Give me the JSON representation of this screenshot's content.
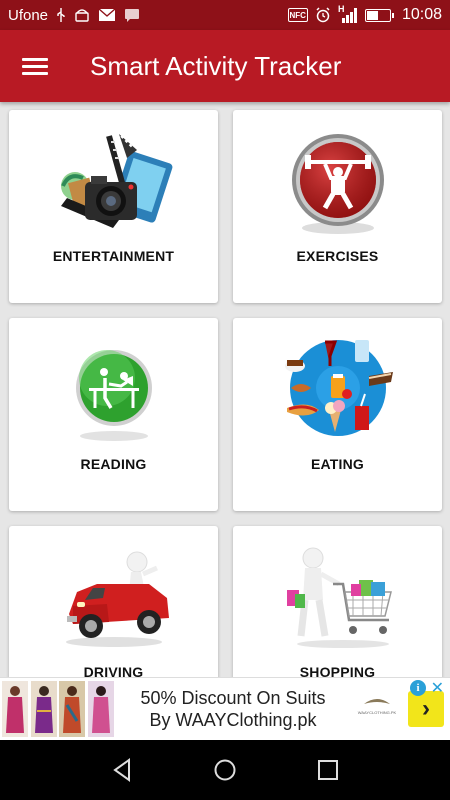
{
  "status_bar": {
    "carrier": "Ufone",
    "time": "10:08",
    "nfc_label": "NFC",
    "signal_label": "H",
    "battery_level": 0.45,
    "icons": [
      "usb-icon",
      "android-icon",
      "gmail-icon",
      "message-icon",
      "nfc-icon",
      "alarm-icon",
      "signal-icon",
      "battery-icon"
    ]
  },
  "app_bar": {
    "title": "Smart Activity Tracker",
    "menu_icon": "hamburger-menu-icon"
  },
  "categories": [
    {
      "label": "ENTERTAINMENT",
      "icon": "camera-film-icon"
    },
    {
      "label": "EXERCISES",
      "icon": "weightlifter-icon"
    },
    {
      "label": "READING",
      "icon": "reading-person-icon"
    },
    {
      "label": "EATING",
      "icon": "food-plate-icon"
    },
    {
      "label": "DRIVING",
      "icon": "red-car-icon"
    },
    {
      "label": "SHOPPING",
      "icon": "shopping-cart-icon"
    }
  ],
  "ad": {
    "line1": "50% Discount On Suits",
    "line2": "By WAAYClothing.pk",
    "logo_label": "WAAYCLOTHING.PK",
    "info_label": "i",
    "close_label": "✕",
    "arrow_label": "›"
  },
  "colors": {
    "status_bar": "#8e1118",
    "app_bar": "#b81a24",
    "background": "#e6e6e6",
    "card": "#ffffff",
    "ad_arrow": "#f2e51a"
  }
}
